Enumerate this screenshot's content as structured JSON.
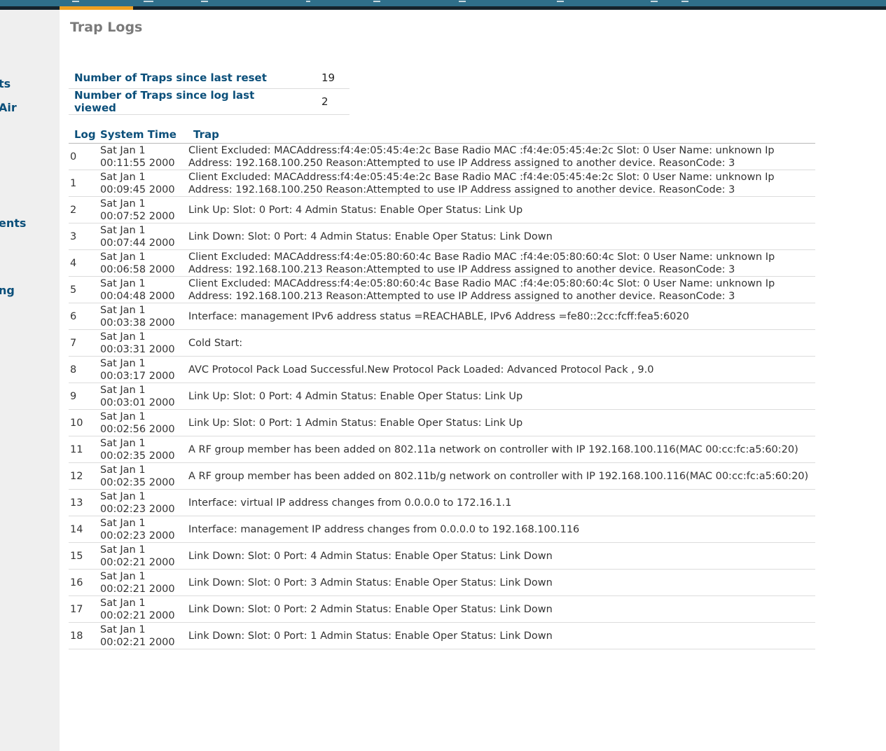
{
  "page_title": "Trap Logs",
  "sidebar": {
    "items": [
      {
        "label": "ts"
      },
      {
        "label": "Air"
      },
      {
        "label": "ents"
      },
      {
        "label": "ng"
      }
    ]
  },
  "summary": [
    {
      "label": "Number of Traps since last reset",
      "value": "19"
    },
    {
      "label": "Number of Traps since log last viewed",
      "value": "2"
    }
  ],
  "table": {
    "headers": [
      "Log",
      "System Time",
      "Trap"
    ],
    "rows": [
      {
        "log": "0",
        "time": "Sat Jan 1\n00:11:55 2000",
        "trap": "Client Excluded: MACAddress:f4:4e:05:45:4e:2c Base Radio MAC :f4:4e:05:45:4e:2c Slot: 0 User Name: unknown Ip Address: 192.168.100.250 Reason:Attempted to use IP Address assigned to another device. ReasonCode: 3"
      },
      {
        "log": "1",
        "time": "Sat Jan 1\n00:09:45 2000",
        "trap": "Client Excluded: MACAddress:f4:4e:05:45:4e:2c Base Radio MAC :f4:4e:05:45:4e:2c Slot: 0 User Name: unknown Ip Address: 192.168.100.250 Reason:Attempted to use IP Address assigned to another device. ReasonCode: 3"
      },
      {
        "log": "2",
        "time": "Sat Jan 1\n00:07:52 2000",
        "trap": "Link Up: Slot: 0 Port: 4 Admin Status: Enable Oper Status: Link Up"
      },
      {
        "log": "3",
        "time": "Sat Jan 1\n00:07:44 2000",
        "trap": "Link Down: Slot: 0 Port: 4 Admin Status: Enable Oper Status: Link Down"
      },
      {
        "log": "4",
        "time": "Sat Jan 1\n00:06:58 2000",
        "trap": "Client Excluded: MACAddress:f4:4e:05:80:60:4c Base Radio MAC :f4:4e:05:80:60:4c Slot: 0 User Name: unknown Ip Address: 192.168.100.213 Reason:Attempted to use IP Address assigned to another device. ReasonCode: 3"
      },
      {
        "log": "5",
        "time": "Sat Jan 1\n00:04:48 2000",
        "trap": "Client Excluded: MACAddress:f4:4e:05:80:60:4c Base Radio MAC :f4:4e:05:80:60:4c Slot: 0 User Name: unknown Ip Address: 192.168.100.213 Reason:Attempted to use IP Address assigned to another device. ReasonCode: 3"
      },
      {
        "log": "6",
        "time": "Sat Jan 1\n00:03:38 2000",
        "trap": "Interface: management IPv6 address status =REACHABLE, IPv6 Address =fe80::2cc:fcff:fea5:6020"
      },
      {
        "log": "7",
        "time": "Sat Jan 1\n00:03:31 2000",
        "trap": "Cold Start:"
      },
      {
        "log": "8",
        "time": "Sat Jan 1\n00:03:17 2000",
        "trap": "AVC Protocol Pack Load Successful.New Protocol Pack Loaded: Advanced Protocol Pack , 9.0"
      },
      {
        "log": "9",
        "time": "Sat Jan 1\n00:03:01 2000",
        "trap": "Link Up: Slot: 0 Port: 4 Admin Status: Enable Oper Status: Link Up"
      },
      {
        "log": "10",
        "time": "Sat Jan 1\n00:02:56 2000",
        "trap": "Link Up: Slot: 0 Port: 1 Admin Status: Enable Oper Status: Link Up"
      },
      {
        "log": "11",
        "time": "Sat Jan 1\n00:02:35 2000",
        "trap": "A RF group member has been added on 802.11a network on controller with IP 192.168.100.116(MAC 00:cc:fc:a5:60:20)"
      },
      {
        "log": "12",
        "time": "Sat Jan 1\n00:02:35 2000",
        "trap": "A RF group member has been added on 802.11b/g network on controller with IP 192.168.100.116(MAC 00:cc:fc:a5:60:20)"
      },
      {
        "log": "13",
        "time": "Sat Jan 1\n00:02:23 2000",
        "trap": "Interface: virtual IP address changes from 0.0.0.0 to 172.16.1.1"
      },
      {
        "log": "14",
        "time": "Sat Jan 1\n00:02:23 2000",
        "trap": "Interface: management IP address changes from 0.0.0.0 to 192.168.100.116"
      },
      {
        "log": "15",
        "time": "Sat Jan 1\n00:02:21 2000",
        "trap": "Link Down: Slot: 0 Port: 4 Admin Status: Enable Oper Status: Link Down"
      },
      {
        "log": "16",
        "time": "Sat Jan 1\n00:02:21 2000",
        "trap": "Link Down: Slot: 0 Port: 3 Admin Status: Enable Oper Status: Link Down"
      },
      {
        "log": "17",
        "time": "Sat Jan 1\n00:02:21 2000",
        "trap": "Link Down: Slot: 0 Port: 2 Admin Status: Enable Oper Status: Link Down"
      },
      {
        "log": "18",
        "time": "Sat Jan 1\n00:02:21 2000",
        "trap": "Link Down: Slot: 0 Port: 1 Admin Status: Enable Oper Status: Link Down"
      }
    ]
  }
}
